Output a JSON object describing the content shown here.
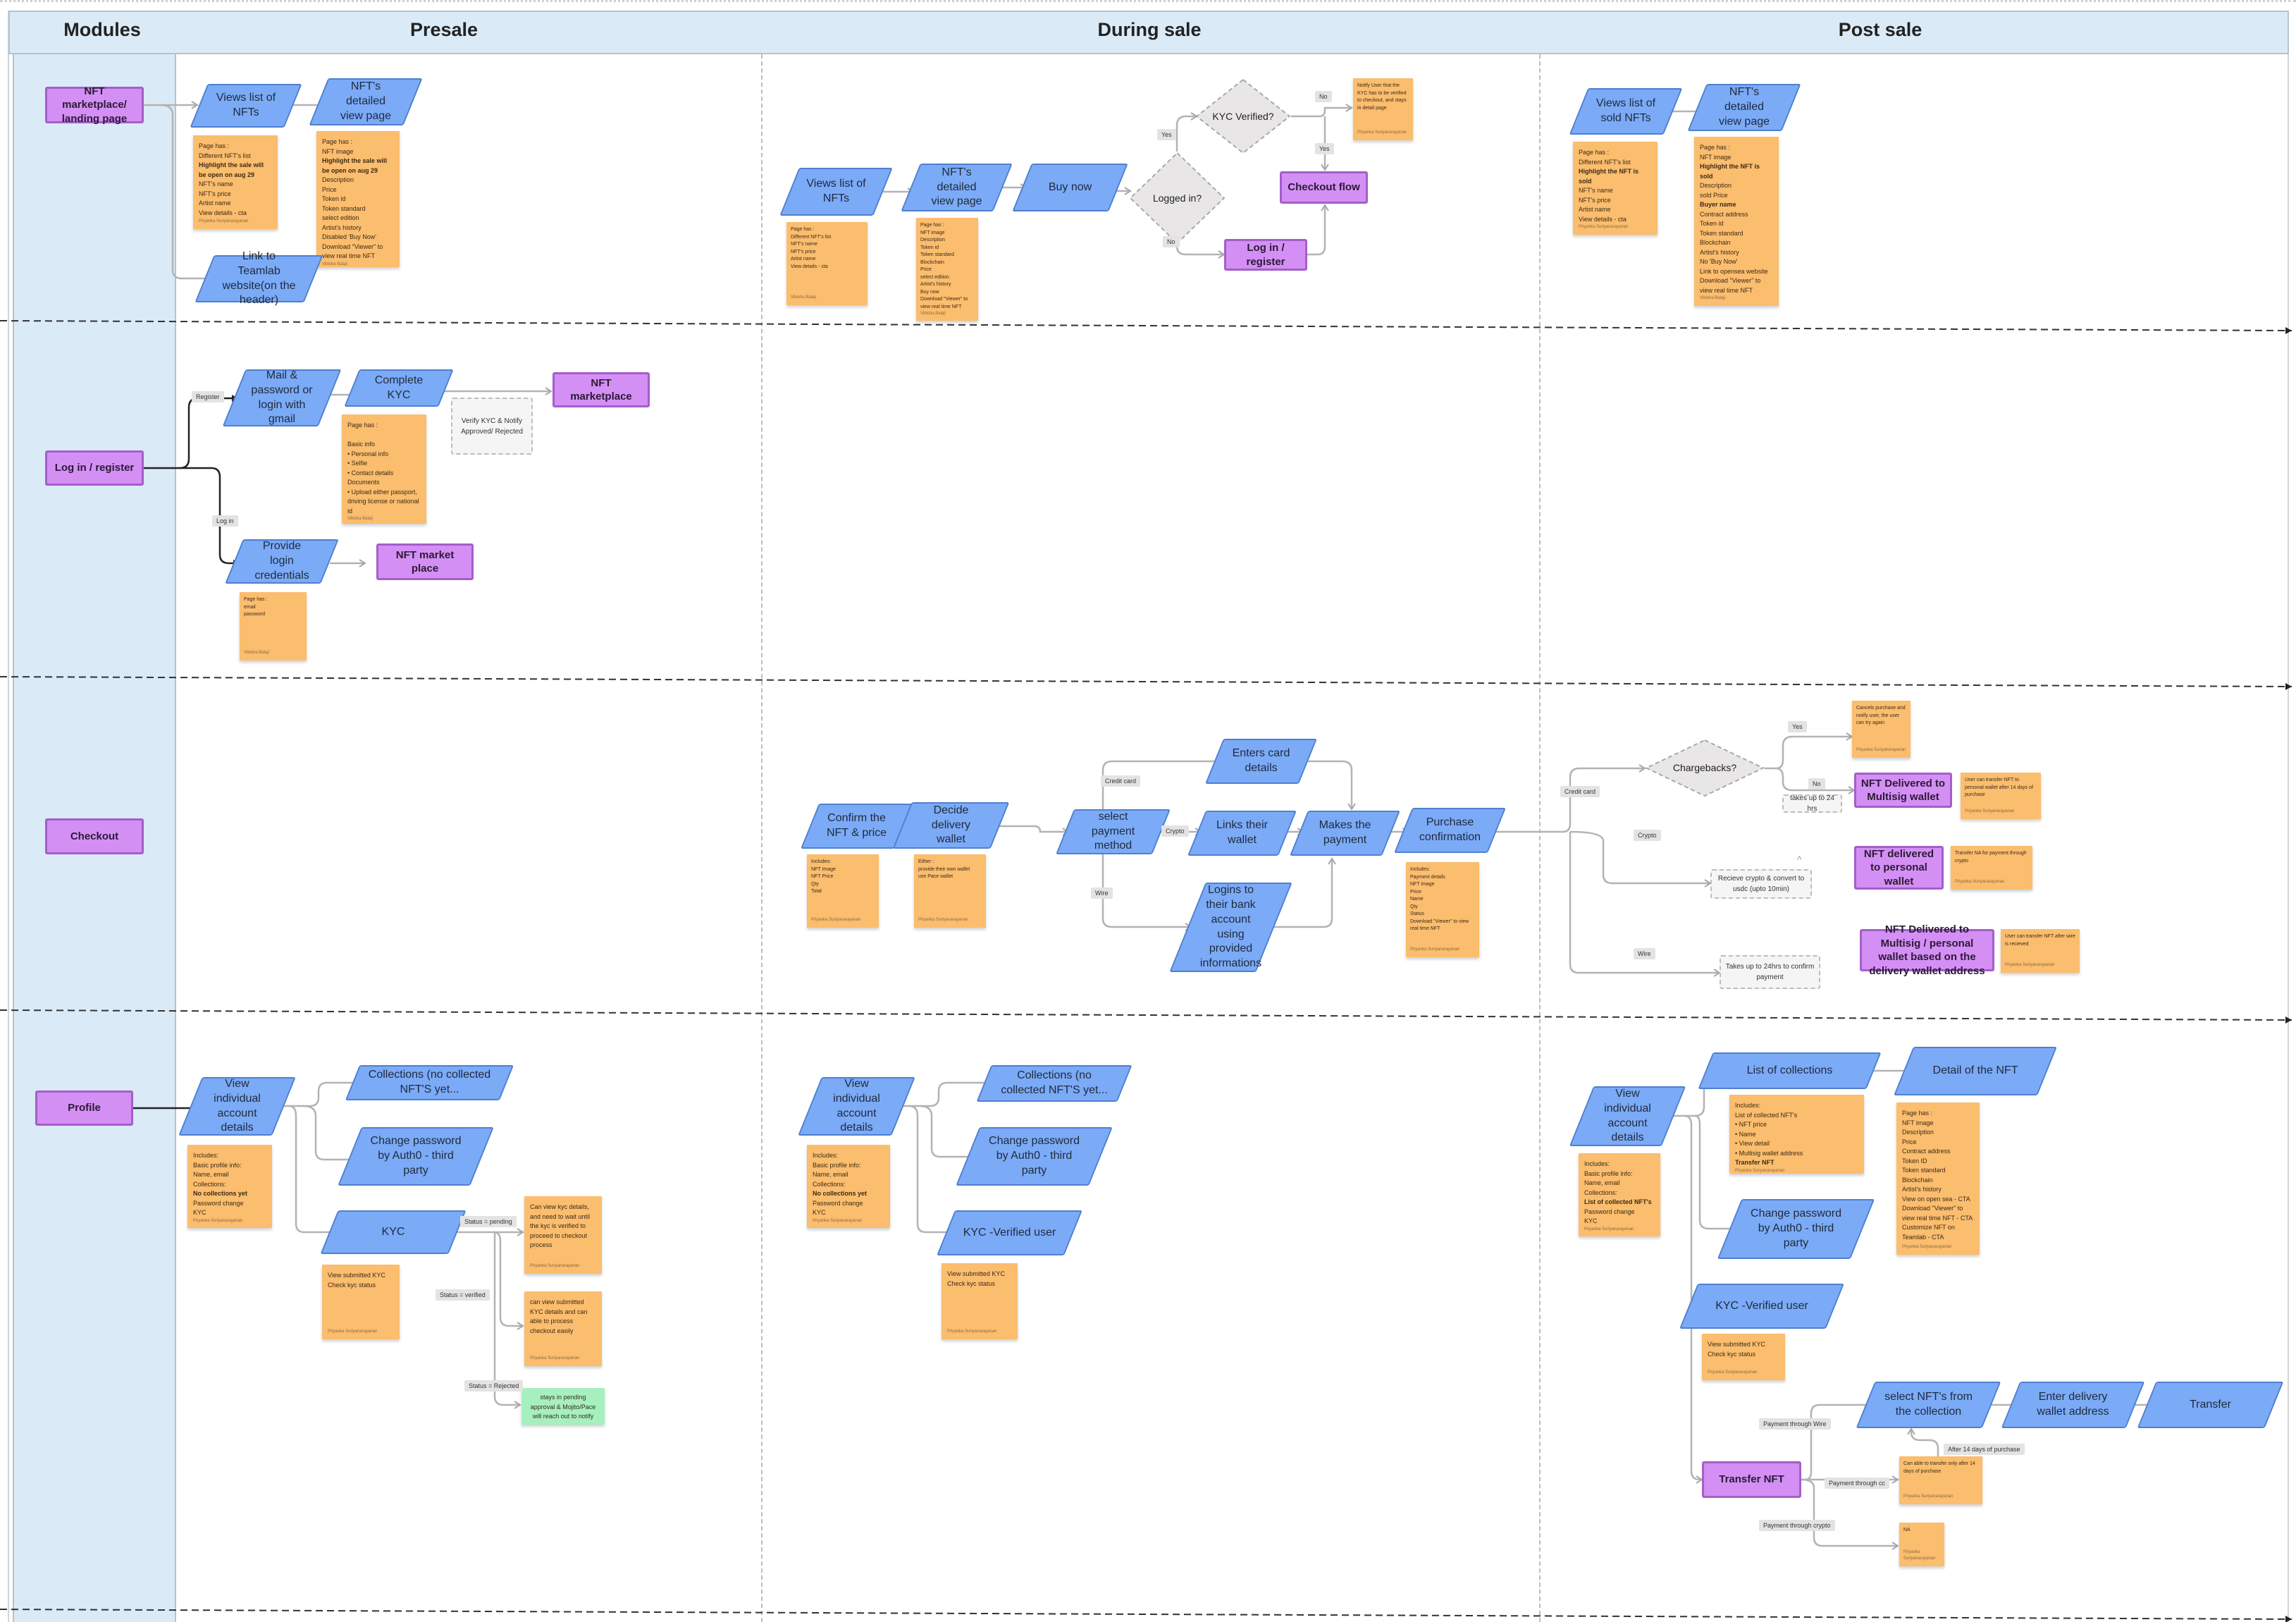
{
  "header": {
    "modules": "Modules",
    "presale": "Presale",
    "during_sale": "During sale",
    "post_sale": "Post sale"
  },
  "colors": {
    "process": "#7baaf7",
    "terminal": "#d48ff5",
    "sticky_note": "#fbbd6e",
    "green_note": "#a6f0c0",
    "lane_header": "#dbeaf7",
    "decision": "#e8e6e6"
  },
  "nodes": {
    "r1_mod": {
      "text": "NFT marketplace/ landing page"
    },
    "r1_pre_list": {
      "text": "Views list of NFTs"
    },
    "r1_pre_detail": {
      "text": "NFT's detailed view page"
    },
    "r1_pre_list_note": {
      "lines": [
        "Page has :",
        "Different NFT's list",
        {
          "text": "Highlight the sale will be open on aug 29",
          "bold": true
        },
        "NFT's name",
        "NFT's price",
        "Artist name",
        "View details - cta"
      ],
      "author": "Priyanka Suriyanarayanan"
    },
    "r1_pre_detail_note": {
      "lines": [
        "Page has :",
        "NFT image",
        {
          "text": "Highlight the sale will be open on aug 29",
          "bold": true
        },
        "Description",
        "Price",
        "Token id",
        "Token standard",
        "select edition",
        "Artist's history",
        "Disabled 'Buy Now'",
        "Download \"Viewer\" to view real time NFT"
      ],
      "author": "Vibisha Balaji"
    },
    "r1_pre_teamlab": {
      "text": "Link to Teamlab website(on the header)"
    },
    "r1_dur_list": {
      "text": "Views list of NFTs"
    },
    "r1_dur_detail": {
      "text": "NFT's detailed view page"
    },
    "r1_dur_buy": {
      "text": "Buy now"
    },
    "r1_dur_logged": {
      "text": "Logged in?"
    },
    "r1_dur_kyc": {
      "text": "KYC Verified?"
    },
    "r1_dur_login": {
      "text": "Log in / register"
    },
    "r1_dur_checkout": {
      "text": "Checkout flow"
    },
    "r1_dur_notify": {
      "lines": [
        "Notify User that the KYC has to be verified to checkout, and stays in detail page"
      ],
      "author": "Priyanka Suriyanarayanan"
    },
    "r1_dur_list_note": {
      "lines": [
        "Page has :",
        "Different NFT's list",
        "NFT's name",
        "NFT's price",
        "Artist name",
        "View details - cta"
      ],
      "author": "Vibisha Balaji"
    },
    "r1_dur_detail_note": {
      "lines": [
        "Page has :",
        "NFT image",
        "Description",
        "Token id",
        "Token standard",
        "Blockchain",
        "Price",
        "select edition",
        "Artist's history",
        "Buy now",
        "Download \"Viewer\" to view real time NFT"
      ],
      "author": "Vibisha Balaji"
    },
    "r1_post_list": {
      "text": "Views list of sold NFTs"
    },
    "r1_post_detail": {
      "text": "NFT's detailed view page"
    },
    "r1_post_list_note": {
      "lines": [
        "Page has :",
        "Different NFT's list",
        {
          "text": "Highlight the NFT is sold",
          "bold": true
        },
        "NFT's name",
        "NFT's price",
        "Artist name",
        "View details - cta"
      ],
      "author": "Priyanka Suriyanarayanan"
    },
    "r1_post_detail_note": {
      "lines": [
        "Page has :",
        "NFT image",
        {
          "text": "Highlight the NFT is sold",
          "bold": true
        },
        "Description",
        "sold Price",
        {
          "text": "Buyer name",
          "bold": true
        },
        "Contract address",
        "Token id",
        "Token standard",
        "Blockchain",
        "Artist's history",
        "No 'Buy Now'",
        "Link to opensea website",
        "Download \"Viewer\" to view real time NFT"
      ],
      "author": "Vibisha Balaji"
    },
    "r2_mod": {
      "text": "Log in / register"
    },
    "r2_mail": {
      "text": "Mail & password or login with gmail"
    },
    "r2_kyc": {
      "text": "Complete KYC"
    },
    "r2_market": {
      "text": "NFT marketplace"
    },
    "r2_kyc_note": {
      "lines": [
        "Page has :",
        "",
        "Basic info",
        "• Personal info",
        "• Selfie",
        "• Contact details",
        "Documents",
        "• Upload either passport, driving license or national id"
      ],
      "author": "Vibisha Balaji"
    },
    "r2_verify": {
      "text": "Verify KYC & Notify Approved/ Rejected"
    },
    "r2_provide": {
      "text": "Provide login credentials"
    },
    "r2_market2": {
      "text": "NFT market place"
    },
    "r2_provide_note": {
      "lines": [
        "Page has :",
        "email",
        "password"
      ],
      "author": "Vibisha Balaji"
    },
    "r3_mod": {
      "text": "Checkout"
    },
    "r3_confirm": {
      "text": "Confirm the NFT & price"
    },
    "r3_decide": {
      "text": "Decide delivery wallet"
    },
    "r3_confirm_note": {
      "lines": [
        "Includes:",
        "NFT Image",
        "NFT Price",
        "Qty",
        "Total"
      ],
      "author": "Priyanka Suriyanarayanan"
    },
    "r3_decide_note": {
      "lines": [
        "Either :",
        "provide their own wallet",
        "use Pace wallet"
      ],
      "author": "Priyanka Suriyanarayanan"
    },
    "r3_select": {
      "text": "select payment method"
    },
    "r3_card": {
      "text": "Enters card details"
    },
    "r3_links": {
      "text": "Links their wallet"
    },
    "r3_makes": {
      "text": "Makes the payment"
    },
    "r3_bank": {
      "text": "Logins to their bank account using provided informations"
    },
    "r3_purchase": {
      "text": "Purchase confirmation"
    },
    "r3_purchase_note": {
      "lines": [
        "Includes:",
        "Payment details",
        "NFT image",
        "Price",
        "Name",
        "Qty",
        "Status",
        "Download \"Viewer\" to view real time NFT"
      ],
      "author": "Priyanka Suriyanarayanan"
    },
    "r3_chargebacks": {
      "text": "Chargebacks?"
    },
    "r3_cancel_note": {
      "lines": [
        "Cancels purchase and notify user, the user can try again"
      ],
      "author": "Priyanka Suriyanarayanan"
    },
    "r3_multisig": {
      "text": "NFT Delivered to Multisig wallet"
    },
    "r3_multisig_note": {
      "lines": [
        "User can transfer NFT to personal wallet after 14 days of purchase"
      ],
      "author": "Priyanka Suriyanarayanan"
    },
    "r3_24hrs": {
      "text": "takes up to 24 hrs"
    },
    "r3_receive": {
      "text": "Recieve crypto & convert to usdc (upto 10min)"
    },
    "r3_personal": {
      "text": "NFT delivered to personal wallet"
    },
    "r3_personal_note": {
      "lines": [
        "Transfer NA for payment through crypto"
      ],
      "author": "Priyanka Suriyanarayanan"
    },
    "r3_wire_confirm": {
      "text": "Takes up to 24hrs to confirm payment"
    },
    "r3_multi_personal": {
      "text": "NFT Delivered to Multisig / personal wallet based on the delivery wallet address"
    },
    "r3_multi_personal_note": {
      "lines": [
        "User can transfer NFT after wire is recieved"
      ],
      "author": "Priyanka Suriyanarayanan"
    },
    "r4_mod": {
      "text": "Profile"
    },
    "r4_pre_view": {
      "text": "View individual account details"
    },
    "r4_pre_view_note": {
      "lines": [
        "Includes:",
        "Basic profile info:",
        "Name, email",
        "Collections:",
        {
          "text": "No collections yet",
          "bold": true
        },
        "Password change",
        "KYC"
      ],
      "author": "Priyanka Suriyanarayanan"
    },
    "r4_pre_coll": {
      "text": "Collections (no collected NFT'S yet..."
    },
    "r4_pre_pw": {
      "text": "Change password by Auth0 - third party"
    },
    "r4_pre_kyc": {
      "text": "KYC"
    },
    "r4_pre_kyc_note": {
      "lines": [
        "View submitted KYC",
        "Check kyc status"
      ],
      "author": "Priyanka Suriyanarayanan"
    },
    "r4_pending_note": {
      "lines": [
        "Can view kyc details, and need to wait until the kyc is verified to proceed to checkout process"
      ],
      "author": "Priyanka Suriyanarayanan"
    },
    "r4_verified_note": {
      "lines": [
        "can view submitted KYC details and can able to process checkout easily"
      ],
      "author": "Priyanka Suriyanarayanan"
    },
    "r4_rejected_note": {
      "lines": [
        "stays in pending approval & Mojito/Pace will reach out to notify"
      ]
    },
    "r4_dur_view": {
      "text": "View individual account details"
    },
    "r4_dur_view_note": {
      "lines": [
        "Includes:",
        "Basic profile info:",
        "Name, email",
        "Collections:",
        {
          "text": "No collections yet",
          "bold": true
        },
        "Password change",
        "KYC"
      ],
      "author": "Priyanka Suriyanarayanan"
    },
    "r4_dur_coll": {
      "text": "Collections (no collected NFT'S yet..."
    },
    "r4_dur_pw": {
      "text": "Change password by Auth0 - third party"
    },
    "r4_dur_kyc": {
      "text": "KYC -Verified user"
    },
    "r4_dur_kyc_note": {
      "lines": [
        "View submitted KYC",
        "Check kyc status"
      ],
      "author": "Priyanka Suriyanarayanan"
    },
    "r4_post_view": {
      "text": "View individual account details"
    },
    "r4_post_view_note": {
      "lines": [
        "Includes:",
        "Basic profile info:",
        "Name, email",
        "Collections:",
        {
          "text": "List of collected NFT's",
          "bold": true
        },
        "Password change",
        "KYC"
      ],
      "author": "Priyanka Suriyanarayanan"
    },
    "r4_post_list": {
      "text": "List of collections"
    },
    "r4_post_list_note": {
      "lines": [
        "Includes:",
        "List of collected NFT's",
        "• NFT price",
        "• Name",
        "• View detail",
        "• Multisig wallet address",
        {
          "text": "Transfer NFT",
          "bold": true
        }
      ],
      "author": "Priyanka Suriyanarayanan"
    },
    "r4_post_detail": {
      "text": "Detail of the NFT"
    },
    "r4_post_detail_note": {
      "lines": [
        "Page has :",
        "NFT image",
        "Description",
        "Price",
        "Contract address",
        "Token ID",
        "Token standard",
        "Blockchain",
        "Artist's history",
        "View on open sea - CTA",
        "Download \"Viewer\" to view real time NFT - CTA",
        "Customize NFT on Teamlab - CTA"
      ],
      "author": "Priyanka Suriyanarayanan"
    },
    "r4_post_pw": {
      "text": "Change password by Auth0 - third party"
    },
    "r4_post_kyc": {
      "text": "KYC -Verified user"
    },
    "r4_post_kyc_note": {
      "lines": [
        "View submitted KYC",
        "Check kyc status"
      ],
      "author": "Priyanka Suriyanarayanan"
    },
    "r4_transfer_nft": {
      "text": "Transfer NFT"
    },
    "r4_select_nfts": {
      "text": "select NFT's from the collection"
    },
    "r4_enter_wallet": {
      "text": "Enter delivery wallet address"
    },
    "r4_transfer": {
      "text": "Transfer"
    },
    "r4_cc_note": {
      "lines": [
        "Can able to transfer only after 14 days of purchase"
      ],
      "author": "Priyanka Suriyanarayanan"
    },
    "r4_crypto_note": {
      "lines": [
        "NA"
      ],
      "author": "Priyanka Suriyanarayanan"
    }
  },
  "labels": {
    "r1_yes1": "Yes",
    "r1_no1": "No",
    "r1_no2": "No",
    "r1_yes2": "Yes",
    "r2_register": "Register",
    "r2_login": "Log in",
    "r3_credit": "Credit card",
    "r3_crypto": "Crypto",
    "r3_wire": "Wire",
    "r3_post_credit": "Credit card",
    "r3_yes": "Yes",
    "r3_no": "No",
    "r3_post_crypto": "Crypto",
    "r3_post_wire": "Wire",
    "r4_pending": "Status = pending",
    "r4_verified": "Status = verified",
    "r4_rejected": "Status = Rejected",
    "r4_pay_wire": "Payment through Wire",
    "r4_pay_cc": "Payment through cc",
    "r4_pay_crypto": "Payment through crypto",
    "r4_after14": "After 14 days of purchase"
  }
}
